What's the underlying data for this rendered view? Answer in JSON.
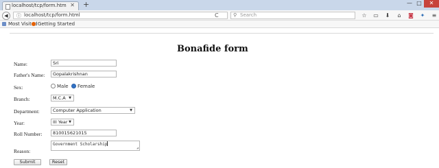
{
  "browser": {
    "tab": {
      "title": "localhost/tcp/form.html"
    },
    "new_tab_symbol": "+",
    "window_controls": {
      "minimize": "—",
      "maximize": "□",
      "close": "✕"
    },
    "back_symbol": "◀",
    "info_symbol": "ⓘ",
    "url": "localhost/tcp/form.html",
    "reload_symbol": "C",
    "search": {
      "placeholder": "Search",
      "icon": "search-icon"
    },
    "toolbar_icons": [
      "star-icon",
      "library-icon",
      "download-icon",
      "home-icon",
      "pocket-icon",
      "extension-icon",
      "menu-icon"
    ],
    "bookmarks": [
      "Most Visited",
      "Getting Started"
    ]
  },
  "form": {
    "title": "Bonafide form",
    "fields": {
      "name": {
        "label": "Name:",
        "value": "Sri"
      },
      "father_name": {
        "label": "Father's Name:",
        "value": "Gopalakrishnan"
      },
      "sex": {
        "label": "Sex:",
        "options": [
          "Male",
          "Female"
        ],
        "selected": "Female"
      },
      "branch": {
        "label": "Branch:",
        "value": "M.C.A"
      },
      "department": {
        "label": "Department:",
        "value": "Computer Application"
      },
      "year": {
        "label": "Year:",
        "value": "III Year"
      },
      "roll_number": {
        "label": "Roll Number:",
        "value": "810015621015"
      },
      "reason": {
        "label": "Reason:",
        "value": "Government Scholarship"
      }
    },
    "buttons": {
      "submit": "Submit",
      "reset": "Reset"
    }
  },
  "colors": {
    "titlebar": "#c9d7ea",
    "close_button": "#c7423b",
    "radio_selected": "#3273c6"
  }
}
